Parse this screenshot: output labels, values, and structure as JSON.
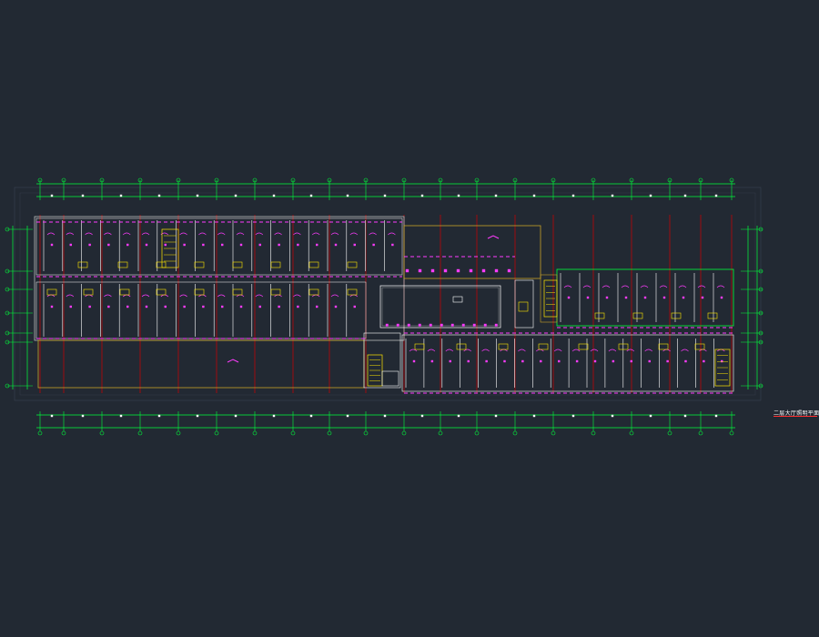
{
  "drawing": {
    "title": "二层大厅照明平面图",
    "colors": {
      "background": "#222933",
      "axis": "#00ff3c",
      "outline": "#c9a227",
      "grid": "#d20000",
      "fixture": "#ff3cff",
      "stair": "#ffe600",
      "wall": "#bbbbbb",
      "white": "#ffffff"
    }
  }
}
